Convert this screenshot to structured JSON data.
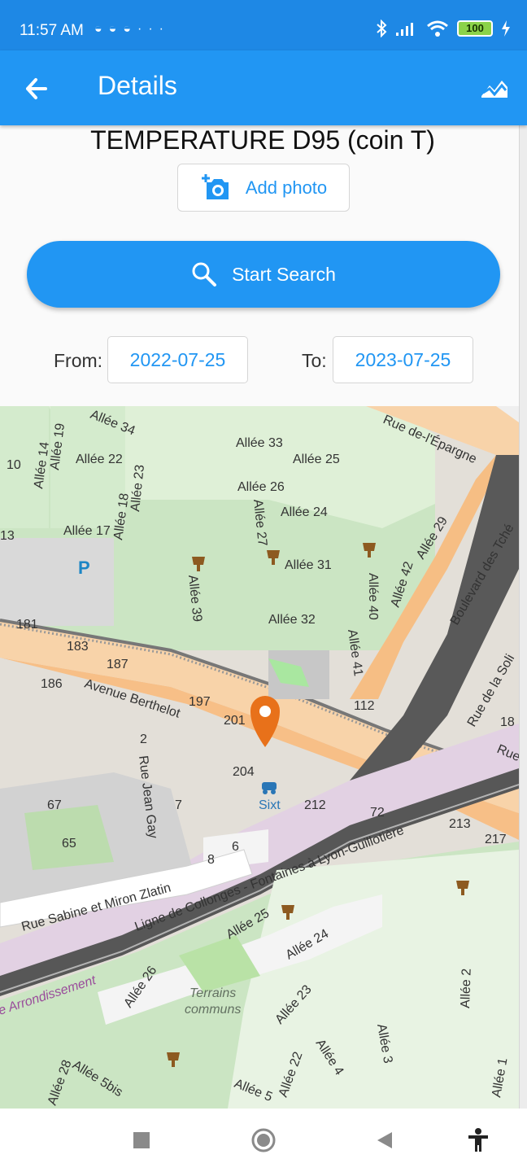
{
  "status_bar": {
    "time": "11:57 AM",
    "left_icons": [
      "discord-icon",
      "discord-icon",
      "discord-icon"
    ],
    "overflow": "···",
    "battery": "100",
    "right_icons": [
      "bluetooth-icon",
      "signal-icon",
      "wifi-icon",
      "battery-icon",
      "charging-icon"
    ]
  },
  "app_bar": {
    "title": "Details",
    "back_icon": "arrow-back-icon",
    "action_icon": "landscape-chart-icon"
  },
  "main": {
    "heading": "TEMPERATURE  D95 (coin T)",
    "add_photo_label": "Add photo",
    "search_label": "Start Search",
    "from_label": "From:",
    "from_value": "2022-07-25",
    "to_label": "To:",
    "to_value": "2023-07-25"
  },
  "map": {
    "labels": {
      "allee33": "Allée 33",
      "allee25a": "Allée 25",
      "allee26a": "Allée 26",
      "allee24a": "Allée 24",
      "allee22a": "Allée 22",
      "allee17": "Allée 17",
      "allee31": "Allée 31",
      "allee32": "Allée 32",
      "allee39": "Allée 39",
      "allee40": "Allée 40",
      "allee41": "Allée 41",
      "allee42": "Allée 42",
      "allee29": "Allée 29",
      "allee27": "Allée 27",
      "allee18": "Allée 18",
      "allee19": "Allée 19",
      "allee14": "Allée 14",
      "allee23a": "Allée 23",
      "allee34": "Allée 34",
      "rue_epargne": "Rue de-l'Épargne",
      "bd_tchecoslovaques": "Boulevard des Tché",
      "avenue_berthelot": "Avenue Berthelot",
      "rue_jean_gay": "Rue Jean Gay",
      "rue_sabine": "Rue Sabine et Miron Zlatin",
      "rue_solidarite": "Rue de la Soli",
      "rue_short": "Rue",
      "ligne": "Ligne de Collonges - Fontaines à Lyon-Guillotière",
      "arrondissement": "e Arrondissement",
      "terrains": "Terrains",
      "communs": "communs",
      "sixt": "Sixt",
      "p": "P",
      "allee25b": "Allée 25",
      "allee24b": "Allée 24",
      "allee26b": "Allée 26",
      "allee23b": "Allée 23",
      "allee22b": "Allée 22",
      "allee5": "Allée 5",
      "allee5bis": "Allée 5bis",
      "allee4": "Allée 4",
      "allee3": "Allée 3",
      "allee2": "Allée 2",
      "allee1": "Allée 1",
      "allee28": "Allée 28",
      "n10": "10",
      "n13": "13",
      "n181": "181",
      "n183": "183",
      "n187": "187",
      "n186": "186",
      "n197": "197",
      "n201": "201",
      "n204": "204",
      "n212": "212",
      "n112": "112",
      "n72": "72",
      "n213": "213",
      "n217": "217",
      "n18": "18",
      "n67": "67",
      "n65": "65",
      "n7": "7",
      "n8": "8",
      "n6": "6",
      "n2": "2"
    }
  },
  "nav": {
    "items": [
      "recents-square-icon",
      "home-circle-icon",
      "back-triangle-icon",
      "accessibility-icon"
    ]
  },
  "colors": {
    "primary": "#2196f3",
    "primary_dark": "#1e88e5",
    "marker": "#e8711a",
    "road": "#f8c68b",
    "green": "#bde0b0"
  }
}
